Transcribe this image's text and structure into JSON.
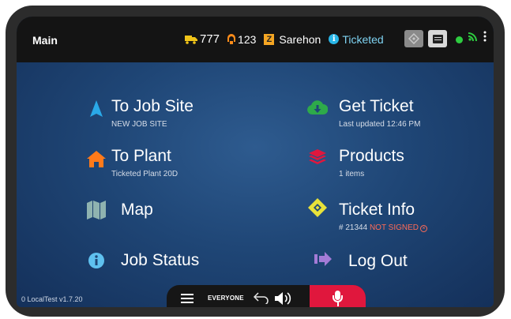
{
  "header": {
    "title": "Main",
    "truck_number": "777",
    "driver_number": "123",
    "company_badge": "Z",
    "driver_name": "Sarehon",
    "status": "Ticketed"
  },
  "menu": {
    "to_job_site": {
      "label": "To Job Site",
      "sub": "NEW JOB SITE"
    },
    "to_plant": {
      "label": "To Plant",
      "sub": "Ticketed Plant 20D"
    },
    "map": {
      "label": "Map"
    },
    "job_status": {
      "label": "Job Status"
    },
    "get_ticket": {
      "label": "Get Ticket",
      "sub": "Last updated 12:46 PM"
    },
    "products": {
      "label": "Products",
      "sub": "1 items"
    },
    "ticket_info": {
      "label": "Ticket Info",
      "ticket_no": "# 21344",
      "signed_status": "NOT SIGNED"
    },
    "log_out": {
      "label": "Log Out"
    }
  },
  "footer": {
    "version": "0 LocalTest v1.7.20",
    "channel": "EVERYONE"
  },
  "colors": {
    "topbar": "#141414",
    "background": "#1f4676",
    "job_site_icon": "#2aa9e8",
    "plant_icon": "#ff7a1a",
    "map_icon": "#8fb3b0",
    "job_status_icon": "#5fc1ef",
    "get_ticket_icon": "#2eaa4a",
    "products_icon": "#e0173d",
    "ticket_info_icon": "#e8e23a",
    "log_out_icon": "#a37bd6",
    "mic_button": "#e0173d",
    "online": "#2ecc40"
  },
  "icons": {
    "header": [
      "truck-icon",
      "person-icon",
      "company-badge",
      "info-icon",
      "ticket-icon",
      "chat-icon",
      "online-dot",
      "rss-icon",
      "more-vert-icon"
    ],
    "footer": [
      "menu-icon",
      "back-arrow-icon",
      "volume-icon",
      "microphone-icon"
    ]
  }
}
